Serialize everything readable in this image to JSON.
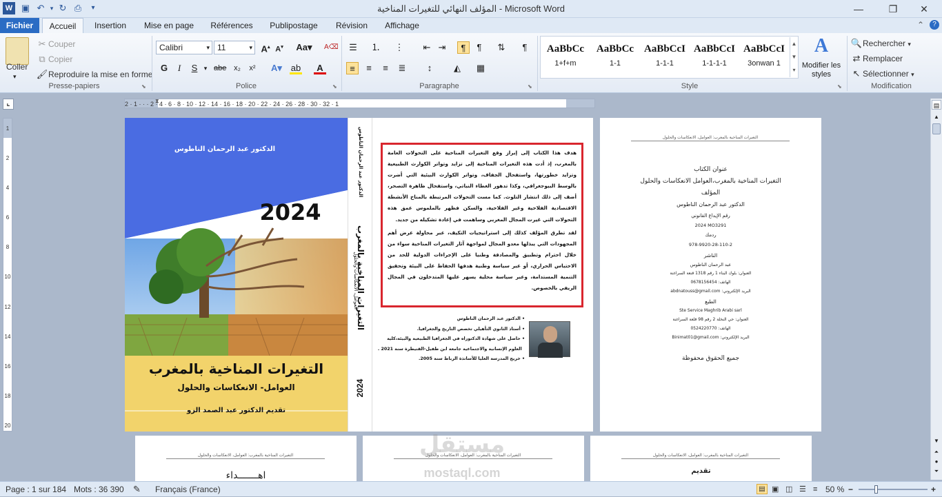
{
  "window": {
    "title": "المؤلف النهائي للتغيرات المناخية  -  Microsoft Word"
  },
  "tabs": [
    {
      "label": "Fichier"
    },
    {
      "label": "Accueil"
    },
    {
      "label": "Insertion"
    },
    {
      "label": "Mise en page"
    },
    {
      "label": "Références"
    },
    {
      "label": "Publipostage"
    },
    {
      "label": "Révision"
    },
    {
      "label": "Affichage"
    }
  ],
  "ribbon": {
    "clipboard": {
      "paste": "Coller",
      "cut": "Couper",
      "copy": "Copier",
      "format_painter": "Reproduire la mise en forme",
      "label": "Presse-papiers"
    },
    "font": {
      "name": "Calibri",
      "size": "11",
      "label": "Police"
    },
    "paragraph": {
      "label": "Paragraphe"
    },
    "styles": {
      "items": [
        {
          "sample": "AaBbCc",
          "name": "1+f+m"
        },
        {
          "sample": "AaBbCc",
          "name": "1-1"
        },
        {
          "sample": "AaBbCcI",
          "name": "1-1-1"
        },
        {
          "sample": "AaBbCcI",
          "name": "1-1-1-1"
        },
        {
          "sample": "AaBbCcI",
          "name": "3onwan 1"
        }
      ],
      "change": "Modifier les styles",
      "label": "Style"
    },
    "editing": {
      "find": "Rechercher",
      "replace": "Remplacer",
      "select": "Sélectionner",
      "label": "Modification"
    }
  },
  "ruler": {
    "ticks": "2 · 1 · · · 2 · 4 · 6 · 8 · 10 · 12 · 14 · 16 · 18 · 20 · 22 · 24 · 26 · 28 · 30 · 32 · 1"
  },
  "vruler": {
    "ticks": [
      "1",
      "2",
      "4",
      "6",
      "8",
      "10",
      "12",
      "14",
      "16",
      "18",
      "20"
    ]
  },
  "cover": {
    "author": "الدكتور عبد الرحمان الناطوس",
    "year": "2024",
    "title": "التغيرات المناخية بالمغرب",
    "subtitle": "العوامل- الانعكاسات والحلول",
    "preface": "تقديم الدكتور عبد الصمد الزو",
    "colors": {
      "blue": "#4a6ce2",
      "yellow": "#f2d36b"
    }
  },
  "spine": {
    "author": "الدكتور عبد الرحمان الناطوس",
    "title": "التغيرات المناخية بالمغرب",
    "subtitle": "العوامل، الانعكاسات والحلول",
    "year": "2024"
  },
  "back": {
    "para1": "هدف هذا الكتاب إلى إبراز وقع التغيرات المناخية على التحولات العامة بالمغرب، إذ أدت هذه التغيرات المناخية إلى تزايد وتواتر الكوارث الطبيعية وتزايد خطورتها، واستفحال الجفاف، وتواتر الكوارث البيئية التي أضرت بالوسط البيوجغرافي، وكذا تدهور الغطاء النباتي، واستفحال ظاهرة التصحر، أضف إلى ذلك انتشار التلوث. كما مست التحولات المرتبطة بالمناخ الأنشطة الاقتصادية الفلاحية وغير الفلاحية، والسكن فظهر بالملموس عمق هذه التحولات التي غيرت المجال المغربي وساهمت في إعادة تشكيله من جديد.",
    "para2": "لقد تطرق المؤلف كذلك إلى استراتيجيات التكيف، عبر محاولة عرض أهم المجهودات التي يبذلها معدو المجال لمواجهة آثار التغيرات المناخية سواء من خلال احترام وتطبيق والمصادقة وطنيا على الإجراءات الدولية للحد من الاحتباس الحراري، أو عبر سياسة وطنية هدفها الحفاظ على البيئة وتحقيق التنمية المستدامة، وعبر سياسة محلية يسهر عليها المتدخلون في المجال الريفي بالخصوص.",
    "bio": [
      "الدكتور عبد الرحمان الناطوس",
      "أستاذ الثانوي التأهيلي تخصص التاريخ والجغرافيا.",
      "حاصل على شهادة الدكتوراه في الجغرافيا الطبيعية والبيئة،كلية",
      "العلوم الإنسانية والاجتماعية جامعة ابن طفيل-القنيطرة سنة 2021 .",
      "خريج المدرسة العليا للأساتذة الرباط سنة 2005."
    ],
    "border_color": "#d9262e"
  },
  "page3": {
    "header": "التغيرات المناخية بالمغرب: العوامل، الانعكاسات والحلول",
    "lines": [
      "عنوان الكتاب",
      "التغيرات المناخية بالمغرب،العوامل الانعكاسات والحلول",
      "المؤلف",
      "الدكتور عبد الرحمان الناطوس",
      "رقم الإيداع القانوني",
      "2024 MO3291",
      "ردمك",
      "978-9920-28-110-2",
      "الناشر",
      "عبد الرحمان الناطوس",
      "العنوان: بلوك البناء 1 رقم 1318 قنعة السراغنة",
      "الهاتف: 0678156454",
      "البريد الإلكتروني: abdnatouss@gmail.com",
      "الطبع",
      "Ste Service Maghrib Arabi sarl",
      "العنوان: حي النخلة 2 رقم 98 قلعة السراغنة",
      "الهاتف: 0524220770",
      "البريد الإلكتروني: Binimat01@gmail.com",
      "جميع الحقوق محفوظة"
    ]
  },
  "lower_pages": [
    {
      "header": "التغيرات المناخية بالمغرب: العوامل، الانعكاسات والحلول",
      "text": "اهـــــــداء"
    },
    {
      "header": "التغيرات المناخية بالمغرب: العوامل، الانعكاسات والحلول",
      "text": ""
    },
    {
      "header": "التغيرات المناخية بالمغرب: العوامل، الانعكاسات والحلول",
      "text": "تقديم"
    }
  ],
  "watermark": {
    "brand": "مستقل",
    "url": "mostaql.com"
  },
  "status": {
    "page": "Page : 1 sur 184",
    "words": "Mots : 36 390",
    "language": "Français (France)",
    "zoom": "50 %",
    "zoom_level": 0.5
  }
}
